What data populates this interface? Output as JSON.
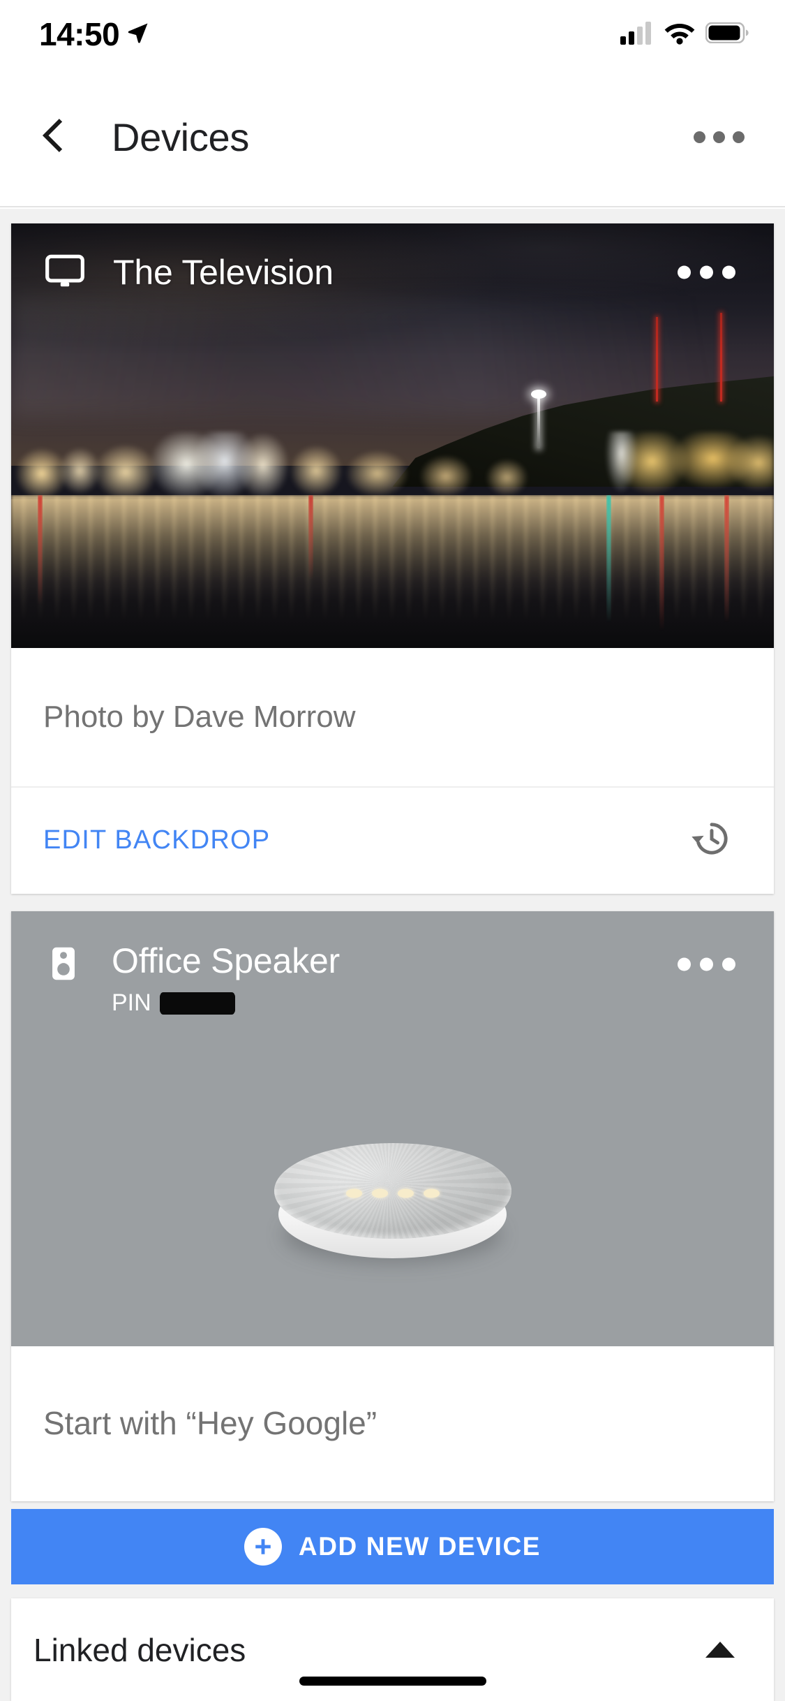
{
  "status_bar": {
    "time": "14:50",
    "location_icon": "location-arrow-icon",
    "cellular_icon": "cellular-signal-icon",
    "cellular_bars_filled": 2,
    "cellular_bars_total": 4,
    "wifi_icon": "wifi-icon",
    "battery_icon": "battery-icon",
    "battery_level_percent": 88
  },
  "nav": {
    "back_icon": "chevron-left-icon",
    "title": "Devices",
    "overflow_icon": "more-horizontal-icon"
  },
  "devices": [
    {
      "id": "television",
      "name": "The Television",
      "type_icon": "tv-icon",
      "overflow_icon": "more-horizontal-icon",
      "backdrop_credit": "Photo by Dave Morrow",
      "action_label": "EDIT BACKDROP",
      "history_icon": "history-restore-icon",
      "backdrop_description": "Night city skyline reflected in calm water"
    },
    {
      "id": "office-speaker",
      "name": "Office Speaker",
      "type_icon": "speaker-icon",
      "pin_label": "PIN",
      "pin_value": "",
      "pin_redacted": true,
      "overflow_icon": "more-horizontal-icon",
      "hint": "Start with “Hey Google”",
      "product_image": "google-home-mini"
    }
  ],
  "add_device": {
    "label": "ADD NEW DEVICE",
    "icon": "plus-circle-icon"
  },
  "linked_devices": {
    "label": "Linked devices",
    "expand_icon": "caret-up-icon",
    "expanded": true
  },
  "colors": {
    "accent_blue": "#4285f4",
    "nav_title": "#202124",
    "secondary_text": "#737373",
    "speaker_card_bg": "#9b9fa2",
    "page_bg": "#f1f1f1"
  }
}
